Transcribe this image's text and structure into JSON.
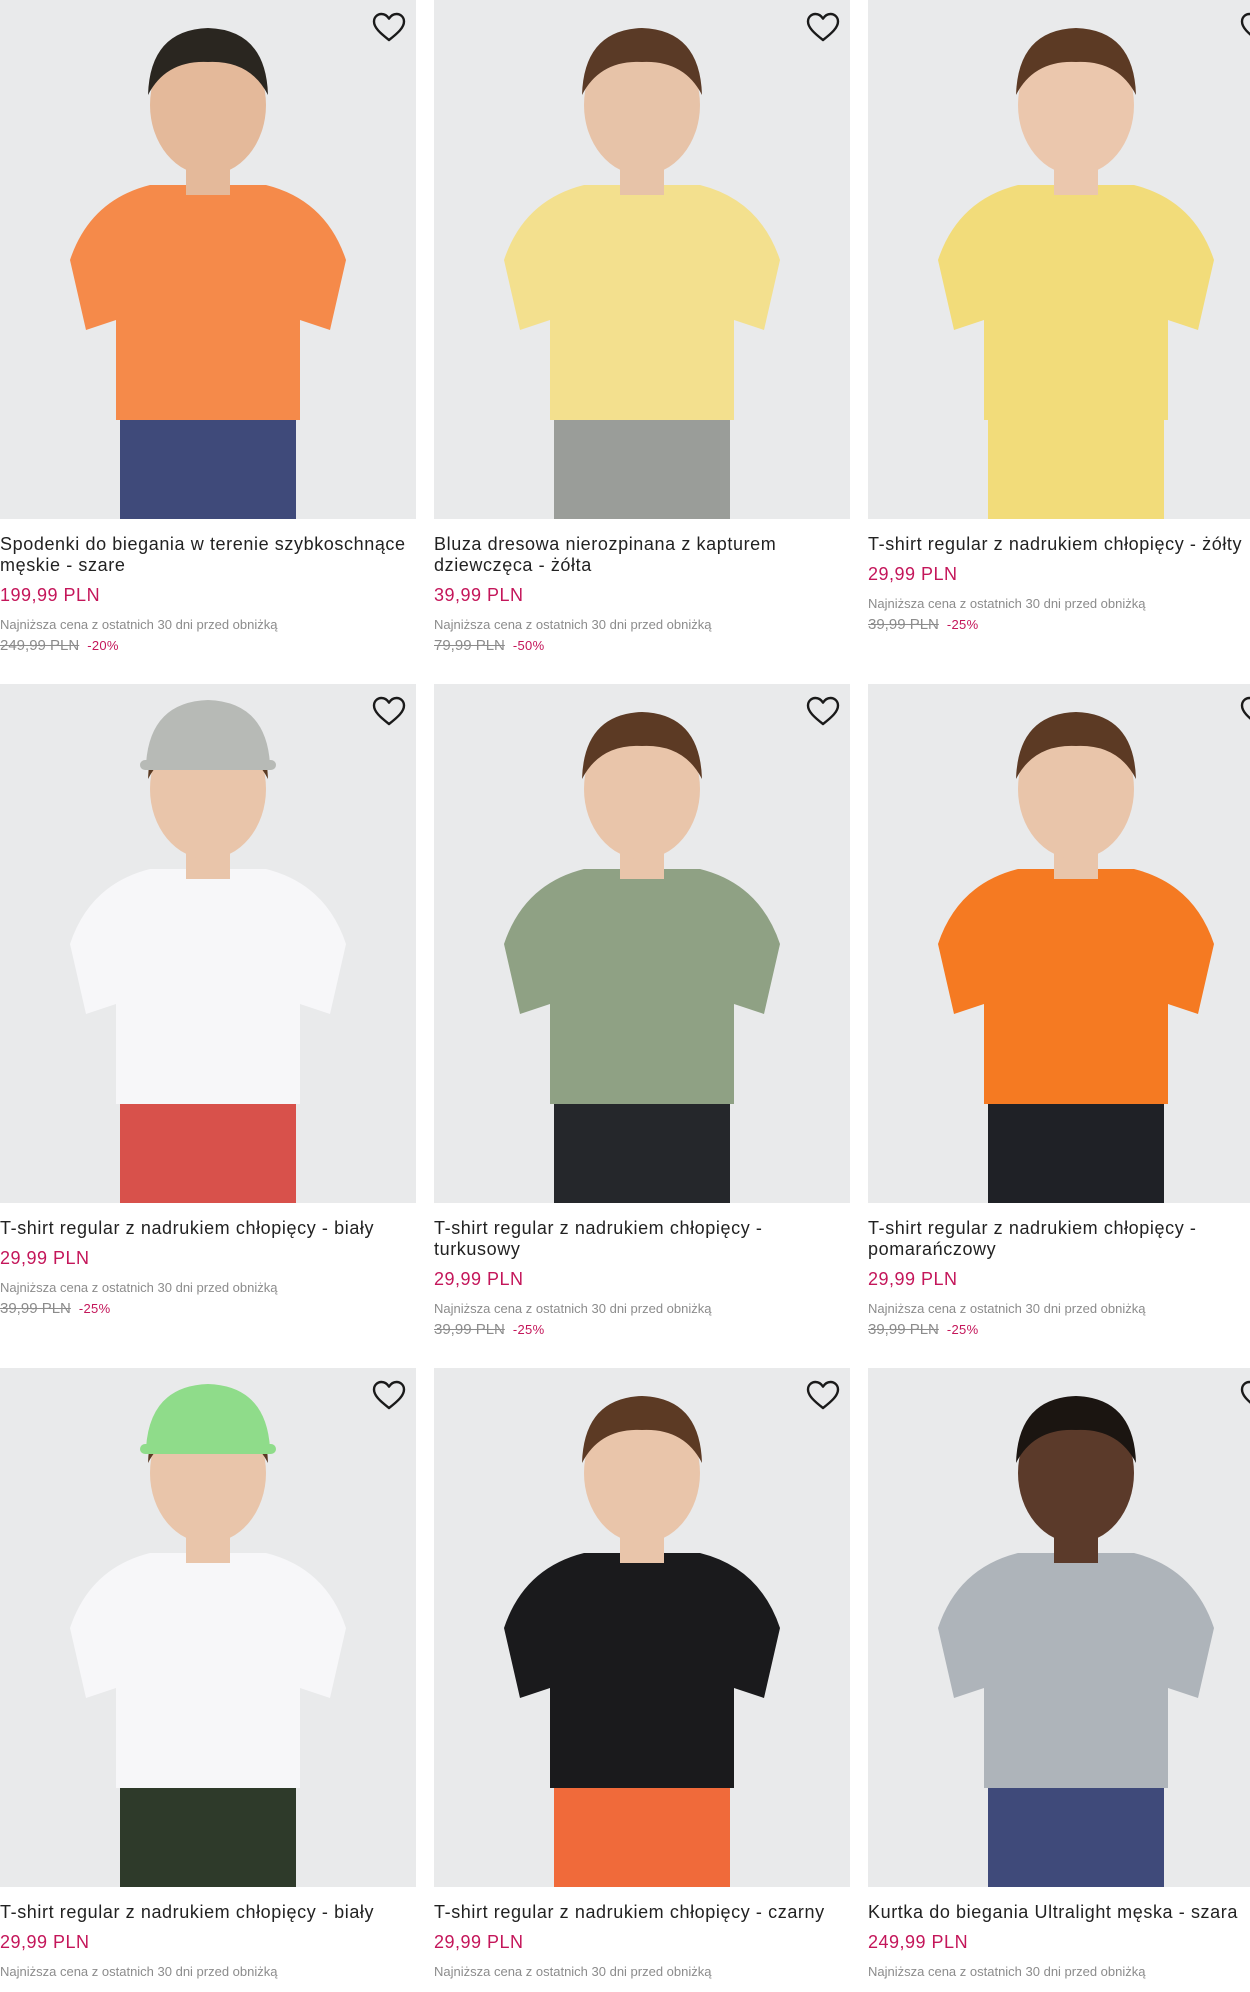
{
  "colors": {
    "price": "#c4165a",
    "muted": "#8c8c8c",
    "image_bg": "#e9eaeb"
  },
  "icons": {
    "favorite": "heart-outline-icon"
  },
  "products": [
    {
      "title": "Spodenki do biegania w terenie szybkoschnące męskie - szare",
      "price": "199,99 PLN",
      "lowest_note": "Najniższa cena z ostatnich 30 dni przed obniżką",
      "old_price": "249,99 PLN",
      "discount": "-20%",
      "shirt": "#f58a4a",
      "bottom": "#3f4a7a",
      "skin": "#e4b99a",
      "hair": "#2a2620",
      "cap": ""
    },
    {
      "title": "Bluza dresowa nierozpinana z kapturem dziewczęca - żółta",
      "price": "39,99 PLN",
      "lowest_note": "Najniższa cena z ostatnich 30 dni przed obniżką",
      "old_price": "79,99 PLN",
      "discount": "-50%",
      "shirt": "#f3e08e",
      "bottom": "#9a9d99",
      "skin": "#e7c3a8",
      "hair": "#5a3a26",
      "cap": ""
    },
    {
      "title": "T-shirt regular z nadrukiem chłopięcy - żółty",
      "price": "29,99 PLN",
      "lowest_note": "Najniższa cena z ostatnich 30 dni przed obniżką",
      "old_price": "39,99 PLN",
      "discount": "-25%",
      "shirt": "#f2dc7a",
      "bottom": "#f2dc7a",
      "skin": "#ebc7ad",
      "hair": "#5c3a24",
      "cap": ""
    },
    {
      "title": "T-shirt regular z nadrukiem chłopięcy - biały",
      "price": "29,99 PLN",
      "lowest_note": "Najniższa cena z ostatnich 30 dni przed obniżką",
      "old_price": "39,99 PLN",
      "discount": "-25%",
      "shirt": "#f7f7f9",
      "bottom": "#d8514b",
      "skin": "#e9c5aa",
      "hair": "#5a3a22",
      "cap": "#b7bab6"
    },
    {
      "title": "T-shirt regular z nadrukiem chłopięcy - turkusowy",
      "price": "29,99 PLN",
      "lowest_note": "Najniższa cena z ostatnich 30 dni przed obniżką",
      "old_price": "39,99 PLN",
      "discount": "-25%",
      "shirt": "#8fa184",
      "bottom": "#25272b",
      "skin": "#e9c5aa",
      "hair": "#5c3a24",
      "cap": ""
    },
    {
      "title": "T-shirt regular z nadrukiem chłopięcy - pomarańczowy",
      "price": "29,99 PLN",
      "lowest_note": "Najniższa cena z ostatnich 30 dni przed obniżką",
      "old_price": "39,99 PLN",
      "discount": "-25%",
      "shirt": "#f57a22",
      "bottom": "#1f2126",
      "skin": "#e9c5aa",
      "hair": "#5c3a24",
      "cap": ""
    },
    {
      "title": "T-shirt regular z nadrukiem chłopięcy - biały",
      "price": "29,99 PLN",
      "lowest_note": "Najniższa cena z ostatnich 30 dni przed obniżką",
      "old_price": "",
      "discount": "",
      "shirt": "#f7f7f9",
      "bottom": "#2e3a2a",
      "skin": "#e9c5aa",
      "hair": "#5c3a24",
      "cap": "#8fdc8a"
    },
    {
      "title": "T-shirt regular z nadrukiem chłopięcy - czarny",
      "price": "29,99 PLN",
      "lowest_note": "Najniższa cena z ostatnich 30 dni przed obniżką",
      "old_price": "",
      "discount": "",
      "shirt": "#1a1a1c",
      "bottom": "#f06a3a",
      "skin": "#e9c5aa",
      "hair": "#5c3a24",
      "cap": ""
    },
    {
      "title": "Kurtka do biegania Ultralight męska - szara",
      "price": "249,99 PLN",
      "lowest_note": "Najniższa cena z ostatnich 30 dni przed obniżką",
      "old_price": "",
      "discount": "",
      "shirt": "#aeb4ba",
      "bottom": "#3f4a7a",
      "skin": "#5b3a2a",
      "hair": "#1b1511",
      "cap": ""
    }
  ]
}
